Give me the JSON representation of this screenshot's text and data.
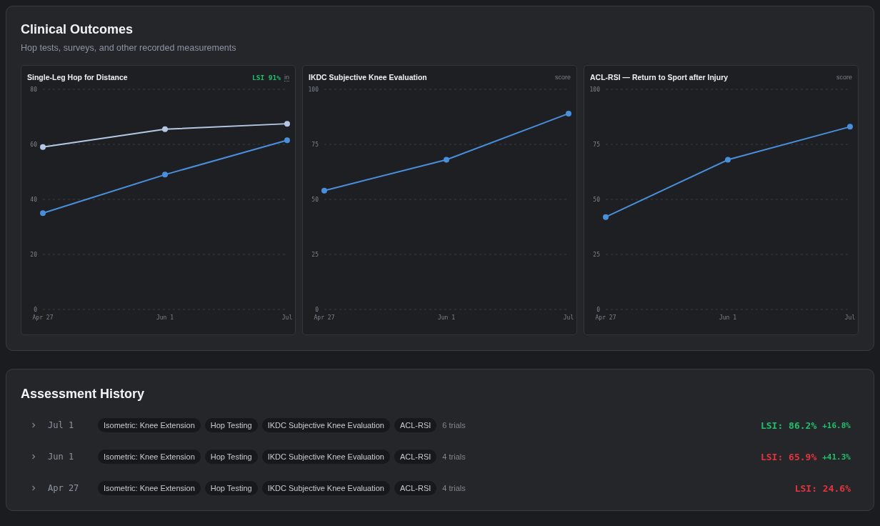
{
  "outcomes": {
    "title": "Clinical Outcomes",
    "subtitle": "Hop tests, surveys, and other recorded measurements",
    "charts": [
      {
        "title": "Single-Leg Hop for Distance",
        "badge": "LSI 91%",
        "unit": "in",
        "chart_data": {
          "type": "line",
          "grid": true,
          "categories": [
            "Apr 27",
            "Jun 1",
            "Jul"
          ],
          "ylim": [
            0,
            80
          ],
          "yticks": [
            0,
            20,
            40,
            60,
            80
          ],
          "series": [
            {
              "color": "#b4c8e6",
              "marker": "circle",
              "values": [
                59,
                65.5,
                67.5
              ]
            },
            {
              "color": "#4a8fdc",
              "marker": "circle",
              "values": [
                35,
                49,
                61.5
              ]
            }
          ]
        }
      },
      {
        "title": "IKDC Subjective Knee Evaluation",
        "unit": "score",
        "chart_data": {
          "type": "line",
          "grid": true,
          "categories": [
            "Apr 27",
            "Jun 1",
            "Jul"
          ],
          "ylim": [
            0,
            100
          ],
          "yticks": [
            0,
            25,
            50,
            75,
            100
          ],
          "series": [
            {
              "color": "#4a8fdc",
              "marker": "circle",
              "values": [
                54,
                68,
                89
              ]
            }
          ]
        }
      },
      {
        "title": "ACL-RSI — Return to Sport after Injury",
        "unit": "score",
        "chart_data": {
          "type": "line",
          "grid": true,
          "categories": [
            "Apr 27",
            "Jun 1",
            "Jul"
          ],
          "ylim": [
            0,
            100
          ],
          "yticks": [
            0,
            25,
            50,
            75,
            100
          ],
          "series": [
            {
              "color": "#4a8fdc",
              "marker": "circle",
              "values": [
                42,
                68,
                83
              ]
            }
          ]
        }
      }
    ]
  },
  "history": {
    "title": "Assessment History",
    "rows": [
      {
        "date": "Jul 1",
        "expanded": false,
        "tags": [
          "Isometric: Knee Extension",
          "Hop Testing",
          "IKDC Subjective Knee Evaluation",
          "ACL-RSI"
        ],
        "trials": "6 trials",
        "lsi": "LSI: 86.2%",
        "color": "#1fc16b",
        "delta": "+16.8%"
      },
      {
        "date": "Jun 1",
        "expanded": false,
        "tags": [
          "Isometric: Knee Extension",
          "Hop Testing",
          "IKDC Subjective Knee Evaluation",
          "ACL-RSI"
        ],
        "trials": "4 trials",
        "lsi": "LSI: 65.9%",
        "color": "#e5343f",
        "delta": "+41.3%"
      },
      {
        "date": "Apr 27",
        "expanded": false,
        "tags": [
          "Isometric: Knee Extension",
          "Hop Testing",
          "IKDC Subjective Knee Evaluation",
          "ACL-RSI"
        ],
        "trials": "4 trials",
        "lsi": "LSI: 24.6%",
        "color": "#e5343f"
      }
    ]
  }
}
